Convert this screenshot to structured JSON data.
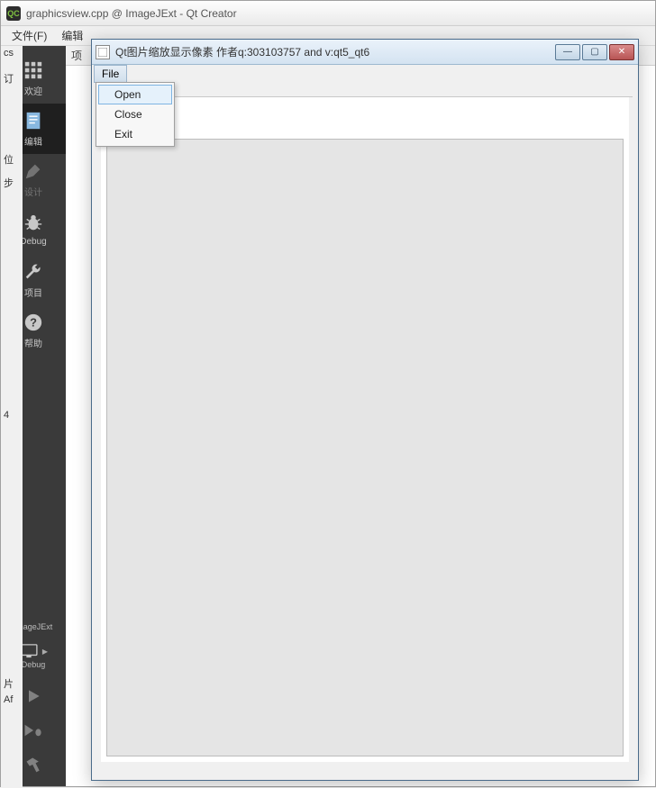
{
  "main": {
    "title": "graphicsview.cpp @ ImageJExt - Qt Creator",
    "menus": [
      {
        "label": "文件(F)"
      },
      {
        "label": "编辑"
      }
    ],
    "editor_tab_fragment": "项"
  },
  "sidebar": {
    "modes": [
      {
        "name": "welcome",
        "label": "欢迎",
        "icon": "grid"
      },
      {
        "name": "edit",
        "label": "编辑",
        "icon": "document",
        "selected": true
      },
      {
        "name": "design",
        "label": "设计",
        "icon": "pencil",
        "disabled": true
      },
      {
        "name": "debug",
        "label": "Debug",
        "icon": "bug"
      },
      {
        "name": "projects",
        "label": "项目",
        "icon": "wrench"
      },
      {
        "name": "help",
        "label": "帮助",
        "icon": "question"
      }
    ],
    "kit": {
      "project": "ImageJExt",
      "mode": "Debug"
    },
    "tools": [
      {
        "name": "run",
        "icon": "play"
      },
      {
        "name": "run-debug",
        "icon": "play-bug"
      },
      {
        "name": "build",
        "icon": "hammer"
      }
    ]
  },
  "left_fragments": [
    "cs",
    "订",
    "位",
    "步",
    "4",
    "片",
    "Af"
  ],
  "appwin": {
    "title": "Qt图片缩放显示像素 作者q:303103757 and v:qt5_qt6",
    "controls": {
      "min": "—",
      "max": "▢",
      "close": "✕"
    },
    "menus": [
      {
        "label": "File"
      }
    ],
    "dropdown": [
      {
        "label": "Open",
        "hover": true
      },
      {
        "label": "Close"
      },
      {
        "label": "Exit"
      }
    ]
  }
}
